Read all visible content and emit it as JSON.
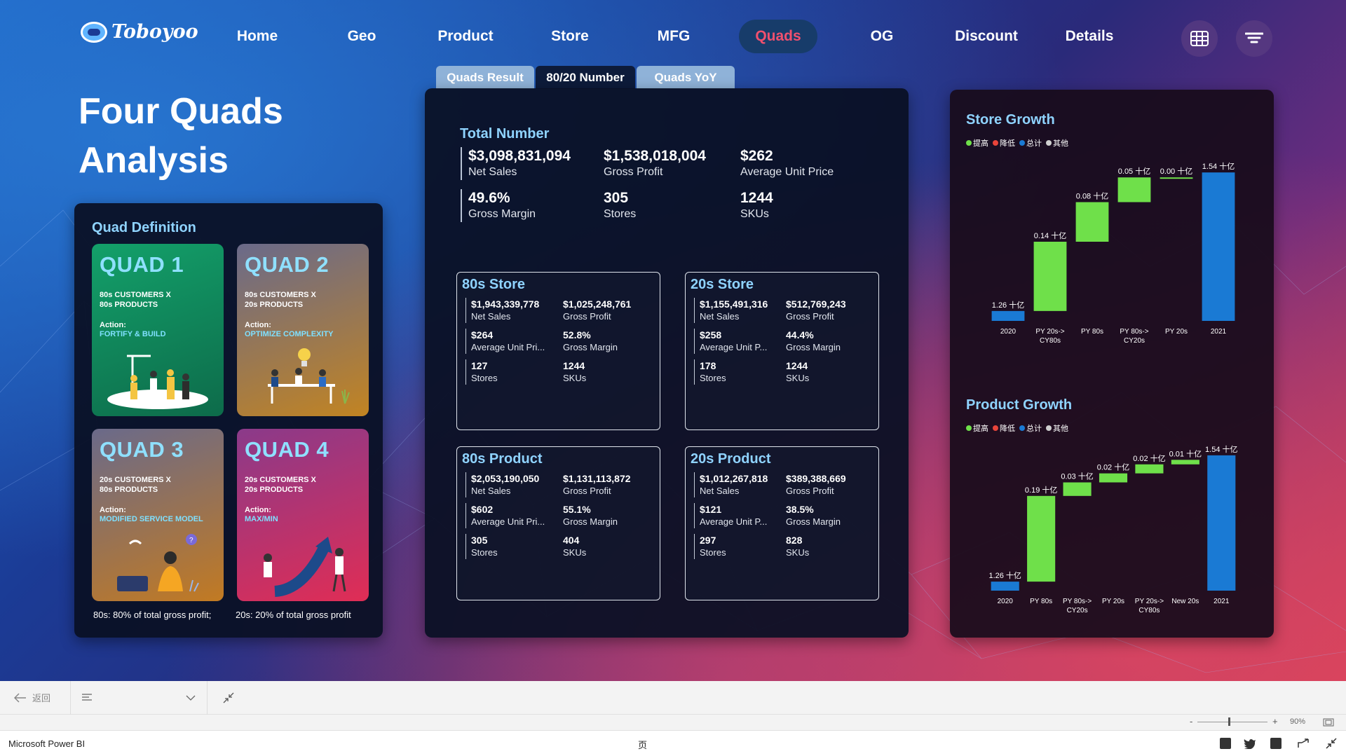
{
  "app": {
    "logo_text": "Toboyoo",
    "window_title": "Microsoft Power BI"
  },
  "nav": {
    "items": [
      "Home",
      "Geo",
      "Product",
      "Store",
      "MFG",
      "Quads",
      "OG",
      "Discount",
      "Details"
    ],
    "active": "Quads",
    "icons": [
      "grid-icon",
      "filter-icon"
    ]
  },
  "tabs": {
    "items": [
      "Quads Result",
      "80/20 Number",
      "Quads YoY"
    ],
    "active": "80/20 Number"
  },
  "page_title": {
    "line1": "Four Quads",
    "line2": "Analysis"
  },
  "quad_definition": {
    "title": "Quad Definition",
    "quads": [
      {
        "title": "QUAD 1",
        "line1": "80s CUSTOMERS X",
        "line2": "80s PRODUCTS",
        "action_label": "Action:",
        "action": "FORTIFY & BUILD",
        "color": "#1a8a5c"
      },
      {
        "title": "QUAD 2",
        "line1": "80s CUSTOMERS X",
        "line2": "20s PRODUCTS",
        "action_label": "Action:",
        "action": "OPTIMIZE COMPLEXITY",
        "color": "#a4762d"
      },
      {
        "title": "QUAD 3",
        "line1": "20s CUSTOMERS X",
        "line2": "80s PRODUCTS",
        "action_label": "Action:",
        "action": "MODIFIED SERVICE MODEL",
        "color": "#a8742f"
      },
      {
        "title": "QUAD 4",
        "line1": "20s CUSTOMERS X",
        "line2": "20s PRODUCTS",
        "action_label": "Action:",
        "action": "MAX/MIN",
        "color": "#c02c5c"
      }
    ],
    "footnote_80": "80s: 80% of total gross  profit;",
    "footnote_20": "20s: 20% of total gross profit"
  },
  "total": {
    "title": "Total Number",
    "metrics": [
      {
        "value": "$3,098,831,094",
        "label": "Net Sales"
      },
      {
        "value": "$1,538,018,004",
        "label": "Gross Profit"
      },
      {
        "value": "$262",
        "label": "Average Unit Price"
      },
      {
        "value": "49.6%",
        "label": "Gross Margin"
      },
      {
        "value": "305",
        "label": "Stores"
      },
      {
        "value": "1244",
        "label": "SKUs"
      }
    ]
  },
  "boxes": [
    {
      "title": "80s Store",
      "items": [
        {
          "value": "$1,943,339,778",
          "label": "Net Sales"
        },
        {
          "value": "$1,025,248,761",
          "label": "Gross Profit"
        },
        {
          "value": "$264",
          "label": "Average Unit Pri..."
        },
        {
          "value": "52.8%",
          "label": "Gross Margin"
        },
        {
          "value": "127",
          "label": "Stores"
        },
        {
          "value": "1244",
          "label": "SKUs"
        }
      ]
    },
    {
      "title": "20s Store",
      "items": [
        {
          "value": "$1,155,491,316",
          "label": "Net Sales"
        },
        {
          "value": "$512,769,243",
          "label": "Gross Profit"
        },
        {
          "value": "$258",
          "label": "Average Unit P..."
        },
        {
          "value": "44.4%",
          "label": "Gross Margin"
        },
        {
          "value": "178",
          "label": "Stores"
        },
        {
          "value": "1244",
          "label": "SKUs"
        }
      ]
    },
    {
      "title": "80s Product",
      "items": [
        {
          "value": "$2,053,190,050",
          "label": "Net Sales"
        },
        {
          "value": "$1,131,113,872",
          "label": "Gross Profit"
        },
        {
          "value": "$602",
          "label": "Average Unit Pri..."
        },
        {
          "value": "55.1%",
          "label": "Gross Margin"
        },
        {
          "value": "305",
          "label": "Stores"
        },
        {
          "value": "404",
          "label": "SKUs"
        }
      ]
    },
    {
      "title": "20s Product",
      "items": [
        {
          "value": "$1,012,267,818",
          "label": "Net Sales"
        },
        {
          "value": "$389,388,669",
          "label": "Gross Profit"
        },
        {
          "value": "$121",
          "label": "Average Unit P..."
        },
        {
          "value": "38.5%",
          "label": "Gross Margin"
        },
        {
          "value": "297",
          "label": "Stores"
        },
        {
          "value": "828",
          "label": "SKUs"
        }
      ]
    }
  ],
  "legend": [
    {
      "label": "提高",
      "color": "#6fe04a"
    },
    {
      "label": "降低",
      "color": "#e8443a"
    },
    {
      "label": "总计",
      "color": "#1a7ad4"
    },
    {
      "label": "其他",
      "color": "#cfcfcf"
    }
  ],
  "chart_data": [
    {
      "type": "bar",
      "subtype": "waterfall",
      "title": "Store Growth",
      "categories": [
        "2020",
        "PY 20s->\nCY80s",
        "PY 80s",
        "PY 80s->\nCY20s",
        "PY 20s",
        "2021"
      ],
      "values": [
        1.26,
        0.14,
        0.08,
        0.05,
        0.0,
        1.54
      ],
      "kinds": [
        "total",
        "increase",
        "increase",
        "increase",
        "increase",
        "total"
      ],
      "data_labels": [
        "1.26 十亿",
        "0.14 十亿",
        "0.08 十亿",
        "0.05 十亿",
        "0.00 十亿",
        "1.54 十亿"
      ],
      "ylim": [
        1.24,
        1.56
      ]
    },
    {
      "type": "bar",
      "subtype": "waterfall",
      "title": "Product Growth",
      "categories": [
        "2020",
        "PY 80s",
        "PY 80s->\nCY20s",
        "PY 20s",
        "PY 20s->\nCY80s",
        "New 20s",
        "2021"
      ],
      "values": [
        1.26,
        0.19,
        0.03,
        0.02,
        0.02,
        0.01,
        1.54
      ],
      "kinds": [
        "total",
        "increase",
        "increase",
        "increase",
        "increase",
        "increase",
        "total"
      ],
      "data_labels": [
        "1.26 十亿",
        "0.19 十亿",
        "0.03 十亿",
        "0.02 十亿",
        "0.02 十亿",
        "0.01 十亿",
        "1.54 十亿"
      ],
      "ylim": [
        1.24,
        1.56
      ]
    }
  ],
  "toolbar": {
    "back_label": "返回",
    "page_label": "页",
    "zoom": "90%"
  },
  "status": {
    "zoom_minus": "-",
    "zoom_plus": "+"
  }
}
